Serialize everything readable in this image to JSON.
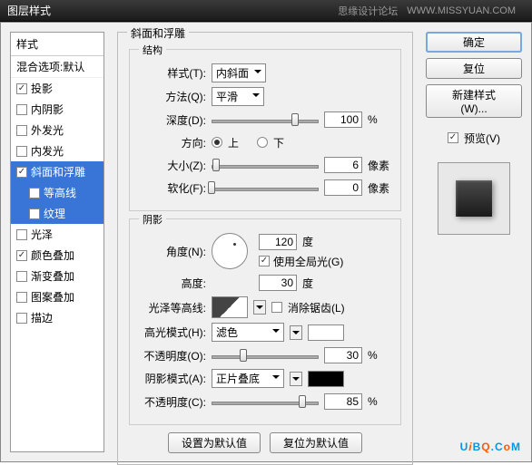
{
  "titlebar": {
    "title": "图层样式",
    "forum": "思缘设计论坛",
    "url": "WWW.MISSYUAN.COM"
  },
  "styles": {
    "header": "样式",
    "blend_label": "混合选项:默认",
    "items": [
      {
        "label": "投影",
        "checked": true
      },
      {
        "label": "内阴影",
        "checked": false
      },
      {
        "label": "外发光",
        "checked": false
      },
      {
        "label": "内发光",
        "checked": false
      },
      {
        "label": "斜面和浮雕",
        "checked": true
      },
      {
        "label": "等高线",
        "checked": false
      },
      {
        "label": "纹理",
        "checked": false
      },
      {
        "label": "光泽",
        "checked": false
      },
      {
        "label": "颜色叠加",
        "checked": true
      },
      {
        "label": "渐变叠加",
        "checked": false
      },
      {
        "label": "图案叠加",
        "checked": false
      },
      {
        "label": "描边",
        "checked": false
      }
    ]
  },
  "panel": {
    "title": "斜面和浮雕",
    "structure": {
      "title": "结构",
      "style_label": "样式(T):",
      "style_value": "内斜面",
      "technique_label": "方法(Q):",
      "technique_value": "平滑",
      "depth_label": "深度(D):",
      "depth_value": "100",
      "depth_unit": "%",
      "direction_label": "方向:",
      "up": "上",
      "down": "下",
      "size_label": "大小(Z):",
      "size_value": "6",
      "size_unit": "像素",
      "soften_label": "软化(F):",
      "soften_value": "0",
      "soften_unit": "像素"
    },
    "shading": {
      "title": "阴影",
      "angle_label": "角度(N):",
      "angle_value": "120",
      "angle_unit": "度",
      "global_light": "使用全局光(G)",
      "altitude_label": "高度:",
      "altitude_value": "30",
      "altitude_unit": "度",
      "gloss_label": "光泽等高线:",
      "antialias": "消除锯齿(L)",
      "hmode_label": "高光模式(H):",
      "hmode_value": "滤色",
      "hopacity_label": "不透明度(O):",
      "hopacity_value": "30",
      "hopacity_unit": "%",
      "smode_label": "阴影模式(A):",
      "smode_value": "正片叠底",
      "sopacity_label": "不透明度(C):",
      "sopacity_value": "85",
      "sopacity_unit": "%"
    },
    "footer": {
      "make_default": "设置为默认值",
      "reset_default": "复位为默认值"
    }
  },
  "right": {
    "ok": "确定",
    "reset": "复位",
    "new_style": "新建样式(W)...",
    "preview": "预览(V)"
  }
}
